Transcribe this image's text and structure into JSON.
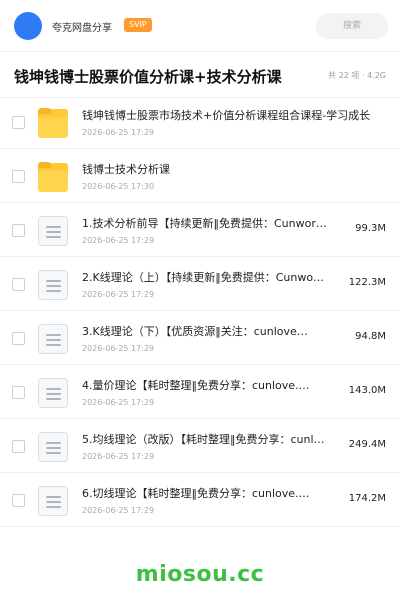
{
  "header": {
    "username": "夸克网盘分享",
    "badge": "SVIP",
    "search_label": "搜索"
  },
  "folder": {
    "title": "钱坤钱博士股票价值分析课+技术分析课",
    "meta": "共 22 项 · 4.2G"
  },
  "items": [
    {
      "type": "folder",
      "name": "钱坤钱博士股票市场技术+价值分析课程组合课程-学习成长",
      "date": "2026-06-25 17:29",
      "size": ""
    },
    {
      "type": "folder",
      "name": "钱博士技术分析课",
      "date": "2026-06-25 17:30",
      "size": ""
    },
    {
      "type": "file",
      "name": "1.技术分析前导【持续更新‖免费提供：Cunwor…",
      "date": "2026-06-25 17:29",
      "size": "99.3M"
    },
    {
      "type": "file",
      "name": "2.K线理论（上）【持续更新‖免费提供：Cunwo…",
      "date": "2026-06-25 17:29",
      "size": "122.3M"
    },
    {
      "type": "file",
      "name": "3.K线理论（下）【优质资源‖关注：cunlove…",
      "date": "2026-06-25 17:29",
      "size": "94.8M"
    },
    {
      "type": "file",
      "name": "4.量价理论【耗时整理‖免费分享：cunlove.…",
      "date": "2026-06-25 17:29",
      "size": "143.0M"
    },
    {
      "type": "file",
      "name": "5.均线理论（改版）【耗时整理‖免费分享：cunl…",
      "date": "2026-06-25 17:29",
      "size": "249.4M"
    },
    {
      "type": "file",
      "name": "6.切线理论【耗时整理‖免费分享：cunlove.…",
      "date": "2026-06-25 17:29",
      "size": "174.2M"
    }
  ],
  "watermark": "miosou.cc",
  "colors": {
    "accent": "#2f7bf5",
    "svip": "#ff9b2e",
    "folder": "#ffc936",
    "watermark": "#3fbf3f"
  }
}
